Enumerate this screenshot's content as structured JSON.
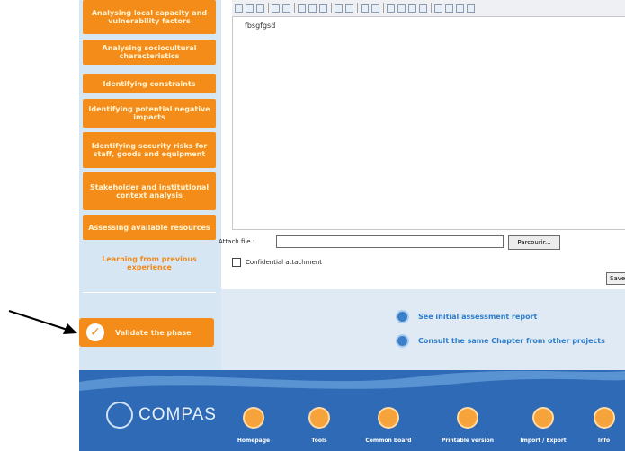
{
  "sidebar": {
    "items": [
      {
        "label": "Analysing local capacity and vulnerability factors"
      },
      {
        "label": "Analysing sociocultural characteristics"
      },
      {
        "label": "Identifying constraints"
      },
      {
        "label": "Identifying potential negative impacts"
      },
      {
        "label": "Identifying security risks for staff, goods and equipment"
      },
      {
        "label": "Stakeholder and institutional context analysis"
      },
      {
        "label": "Assessing available resources"
      },
      {
        "label": "Learning from previous experience"
      }
    ],
    "validate_label": "Validate the phase"
  },
  "editor": {
    "content": "fbsgfgsd"
  },
  "attach": {
    "label": "Attach file :",
    "browse_label": "Parcourir...",
    "confidential_label": "Confidential attachment",
    "save_label": "Save"
  },
  "links": [
    {
      "label": "See initial assessment report"
    },
    {
      "label": "Consult the same Chapter from other projects"
    }
  ],
  "footer": {
    "logo_text": "COMPAS",
    "items": [
      {
        "label": "Homepage"
      },
      {
        "label": "Tools"
      },
      {
        "label": "Common board"
      },
      {
        "label": "Printable version"
      },
      {
        "label": "Import / Export"
      },
      {
        "label": "Info"
      }
    ]
  },
  "colors": {
    "accent": "#f48c1a",
    "footer": "#2f6ab7",
    "link": "#2f7cc9"
  }
}
